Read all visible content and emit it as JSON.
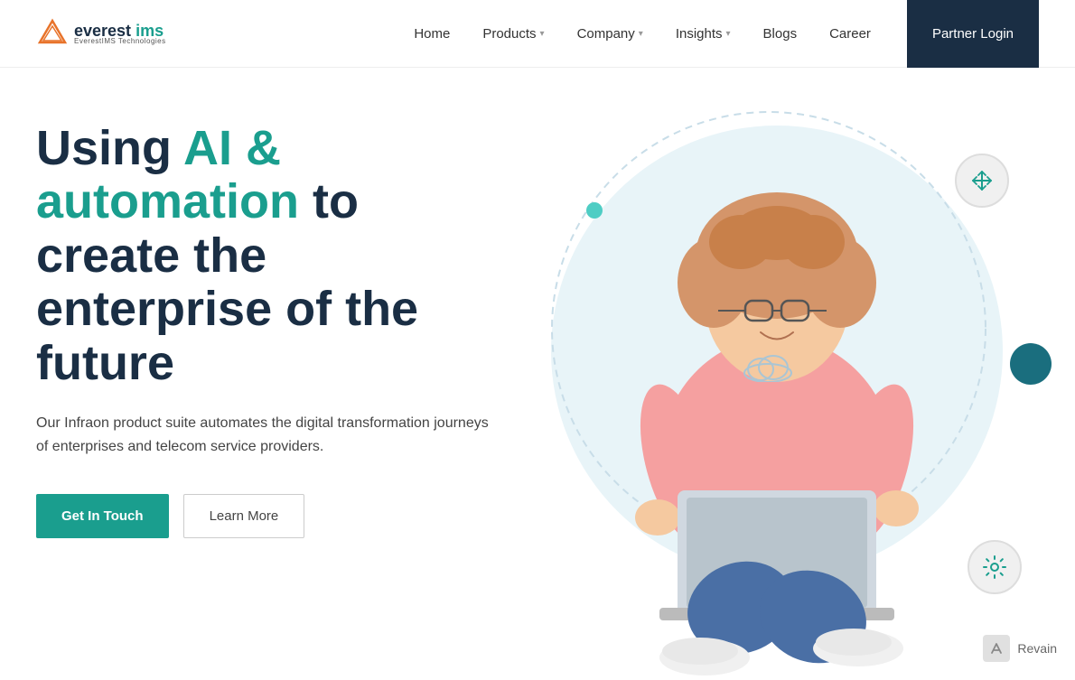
{
  "logo": {
    "text_everest": "everest",
    "text_ims": " ims",
    "sub": "EverestIMS Technologies",
    "icon_alt": "everest-ims-logo"
  },
  "nav": {
    "home_label": "Home",
    "products_label": "Products",
    "company_label": "Company",
    "insights_label": "Insights",
    "blogs_label": "Blogs",
    "career_label": "Career",
    "partner_login_label": "Partner Login"
  },
  "hero": {
    "title_part1": "Using ",
    "title_highlight": "AI & automation",
    "title_part2": " to create the enterprise of the future",
    "description": "Our Infraon product suite automates the digital transformation journeys of enterprises and telecom service providers.",
    "cta_primary": "Get In Touch",
    "cta_secondary": "Learn More"
  },
  "watermark": {
    "icon": "🔍",
    "text": "Revain"
  },
  "colors": {
    "primary": "#1a9e8e",
    "dark": "#1a2e44",
    "accent_teal": "#4ecdc4",
    "bg_circle": "#e8f4f8"
  }
}
